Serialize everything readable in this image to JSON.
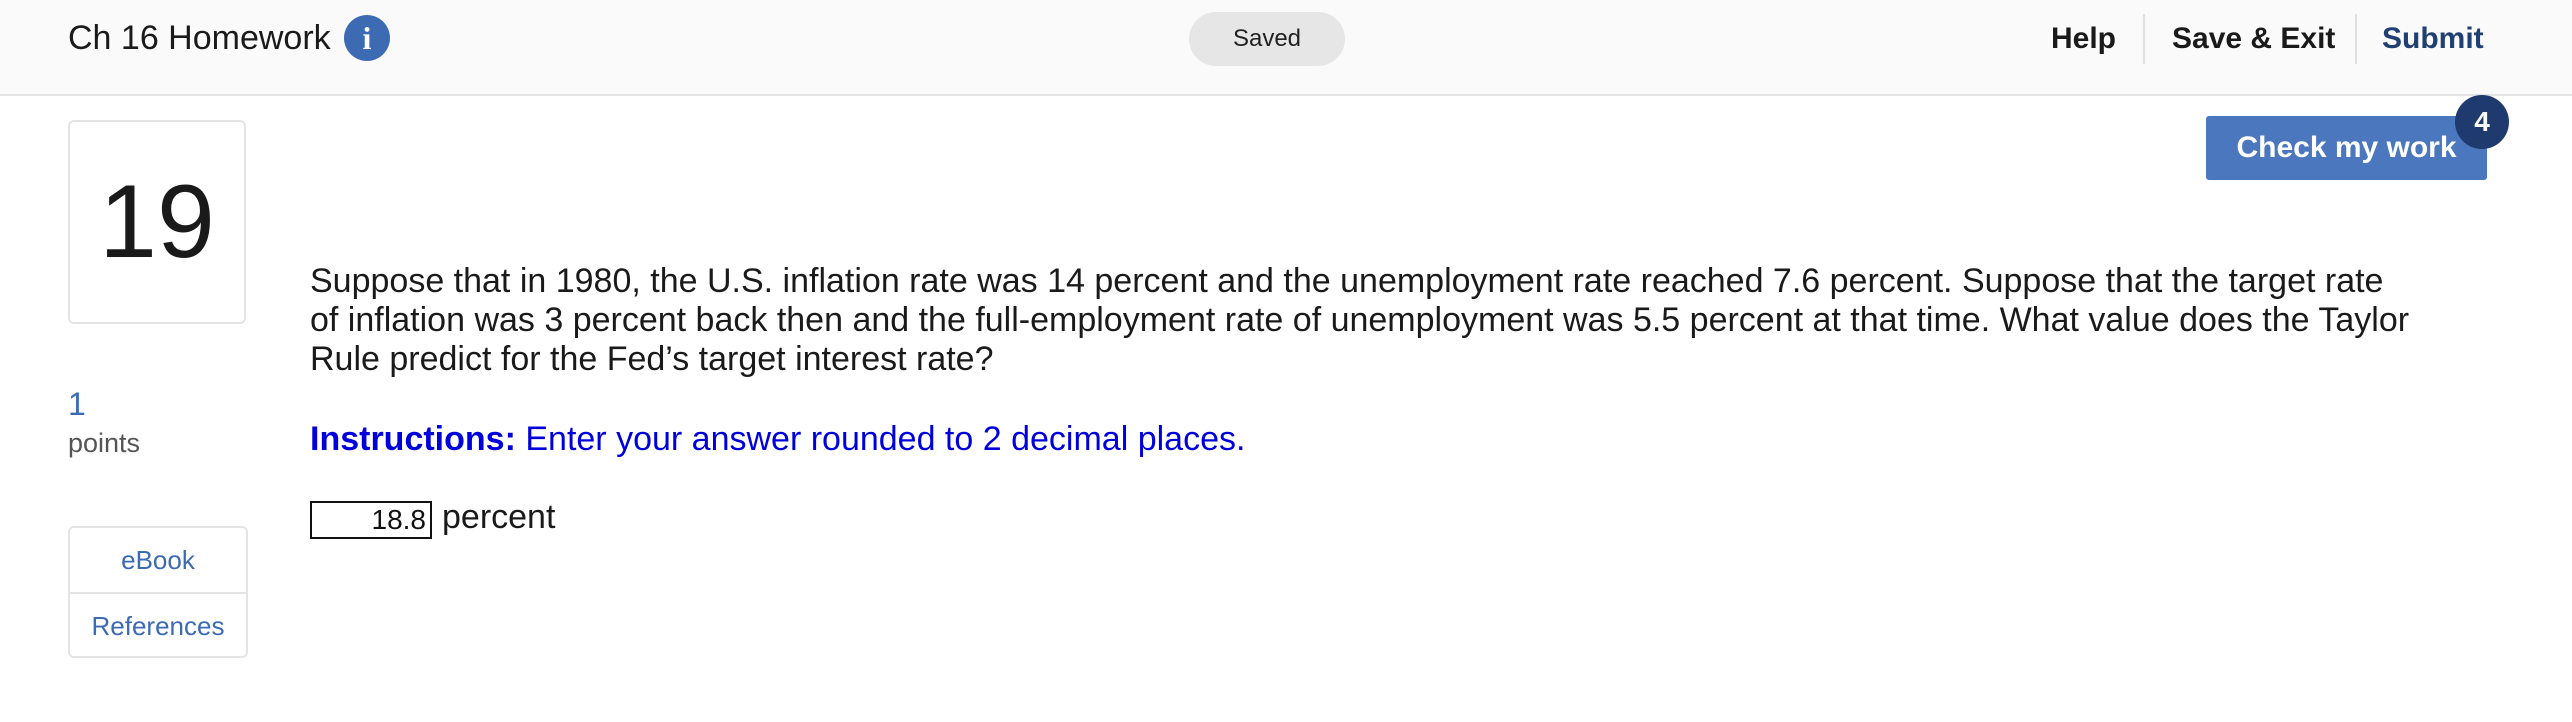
{
  "header": {
    "assignment_title": "Ch 16 Homework",
    "info_icon_glyph": "i",
    "save_status": "Saved",
    "nav": {
      "help": "Help",
      "save_exit": "Save & Exit",
      "submit": "Submit"
    }
  },
  "question": {
    "number": "19",
    "points_value": "1",
    "points_label": "points",
    "resources": [
      "eBook",
      "References"
    ],
    "check_button": "Check my work",
    "attempts_remaining": "4",
    "text": "Suppose that in 1980, the U.S. inflation rate was 14 percent and the unemployment rate reached 7.6 percent. Suppose that the target rate of inflation was 3 percent back then and the full-employment rate of unemployment was 5.5 percent at that time. What value does the Taylor Rule predict for the Fed’s target interest rate?",
    "instructions_label": "Instructions:",
    "instructions_text": "Enter your answer rounded to 2 decimal places.",
    "answer_value": "18.8",
    "answer_unit": "percent"
  },
  "colors": {
    "accent": "#3d6bb3",
    "button": "#4a77bd",
    "badge": "#1e3a6e",
    "submit_text": "#203f73",
    "instructions": "#0000dd"
  },
  "icons": {
    "info": "info-icon"
  }
}
